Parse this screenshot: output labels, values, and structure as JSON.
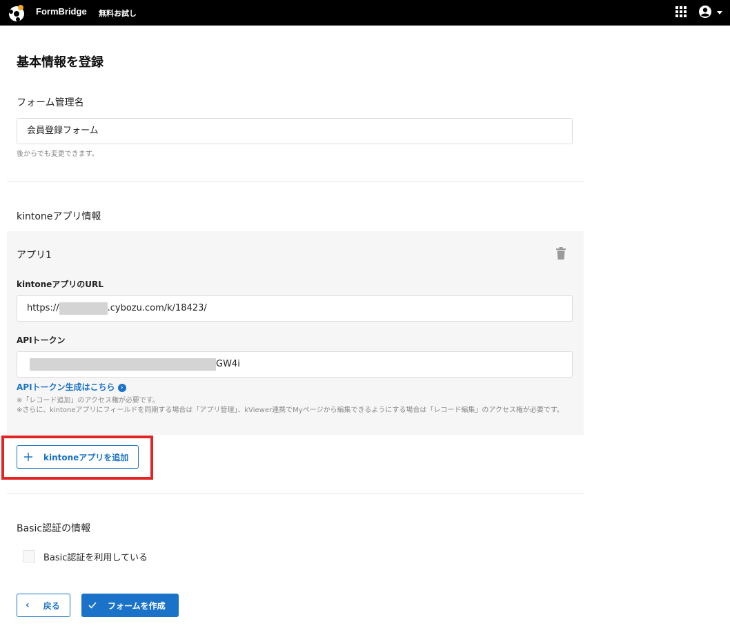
{
  "header": {
    "brand": "FormBridge",
    "trial_badge": "無料お試し"
  },
  "page": {
    "title": "基本情報を登録"
  },
  "form_name": {
    "label": "フォーム管理名",
    "value": "会員登録フォーム",
    "help": "後からでも変更できます。"
  },
  "kintone": {
    "section_label": "kintoneアプリ情報",
    "app": {
      "name": "アプリ1",
      "url_label": "kintoneアプリのURL",
      "url_prefix": "https://",
      "url_suffix": ".cybozu.com/k/18423/",
      "token_label": "APIトークン",
      "token_suffix": "GW4i",
      "token_link": "APIトークン生成はこちら",
      "note1": "※「レコード追加」のアクセス権が必要です。",
      "note2": "※さらに、kintoneアプリにフィールドを同期する場合は「アプリ管理」、kViewer連携でMyページから編集できるようにする場合は「レコード編集」のアクセス権が必要です。"
    },
    "add_button": "kintoneアプリを追加"
  },
  "basic_auth": {
    "section_label": "Basic認証の情報",
    "checkbox_label": "Basic認証を利用している",
    "checked": false
  },
  "footer": {
    "back_button": "戻る",
    "create_button": "フォームを作成"
  },
  "colors": {
    "accent": "#1a73c8",
    "highlight": "#e32424",
    "topbar": "#000000"
  }
}
